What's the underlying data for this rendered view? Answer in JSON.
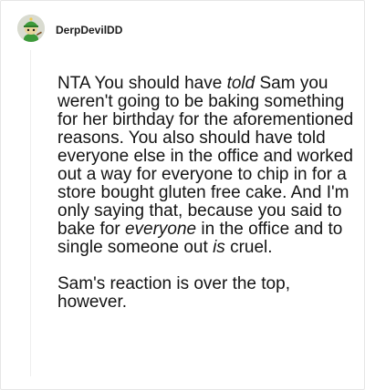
{
  "comment": {
    "author": "DerpDevilDD",
    "paragraph1": [
      {
        "text": "NTA You should have ",
        "italic": false
      },
      {
        "text": "told",
        "italic": true
      },
      {
        "text": " Sam you weren't going to be baking something for her birthday for the aforementioned reasons. You also should have told everyone else in the office and worked out a way for everyone to chip in for a store bought gluten free cake. And I'm only saying that, because you said to bake for ",
        "italic": false
      },
      {
        "text": "everyone",
        "italic": true
      },
      {
        "text": " in the office and to single someone out ",
        "italic": false
      },
      {
        "text": "is",
        "italic": true
      },
      {
        "text": " cruel.",
        "italic": false
      }
    ],
    "paragraph2": "Sam's reaction is over the top, however."
  },
  "icons": {
    "avatar": "snoo-avatar-icon"
  },
  "colors": {
    "avatar_bg": "#d9dbd0",
    "avatar_hat": "#3d9a3a",
    "thread_line": "#eeeeee"
  }
}
